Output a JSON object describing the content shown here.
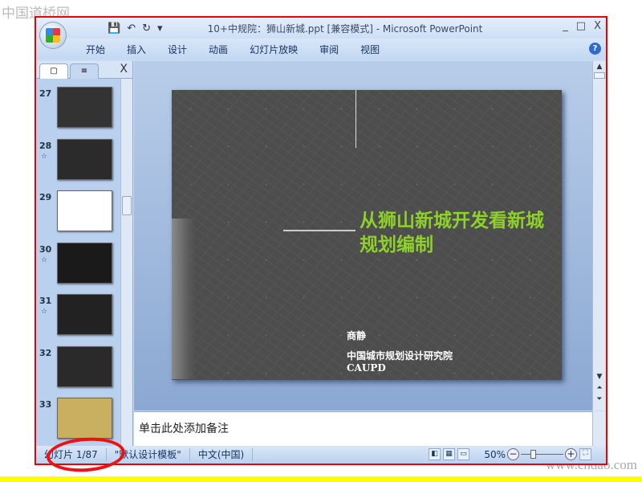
{
  "watermark": {
    "top": "中国道桥网",
    "bottom": "www.cndao.com"
  },
  "window": {
    "title": "10+中规院：狮山新城.ppt [兼容模式] - Microsoft PowerPoint",
    "controls": [
      "_",
      "□",
      "X"
    ]
  },
  "qat": {
    "save": "💾",
    "undo": "↶",
    "redo": "↻",
    "more": "▾"
  },
  "ribbon": {
    "tabs": [
      "开始",
      "插入",
      "设计",
      "动画",
      "幻灯片放映",
      "审阅",
      "视图"
    ],
    "help": "?"
  },
  "left_panel": {
    "tab_slides": "▢",
    "tab_outline": "≡",
    "close": "X",
    "thumbs": [
      {
        "num": "27",
        "star": "",
        "bg": "#333"
      },
      {
        "num": "28",
        "star": "☆",
        "bg": "#2b2b2b"
      },
      {
        "num": "29",
        "star": "",
        "bg": "#fff"
      },
      {
        "num": "30",
        "star": "☆",
        "bg": "#1a1a1a"
      },
      {
        "num": "31",
        "star": "☆",
        "bg": "#222"
      },
      {
        "num": "32",
        "star": "",
        "bg": "#2a2a2a"
      },
      {
        "num": "33",
        "star": "",
        "bg": "#c8b060"
      }
    ]
  },
  "slide": {
    "title": "从狮山新城开发看新城规划编制",
    "author": "商静",
    "org": "中国城市规划设计研究院",
    "org_en": "CAUPD",
    "title_color": "#8ed12a"
  },
  "notes": {
    "placeholder": "单击此处添加备注"
  },
  "status": {
    "slide": "幻灯片 1/87",
    "template": "\"默认设计模板\"",
    "language": "中文(中国)",
    "zoom": "50%",
    "zoom_percent": 50
  }
}
